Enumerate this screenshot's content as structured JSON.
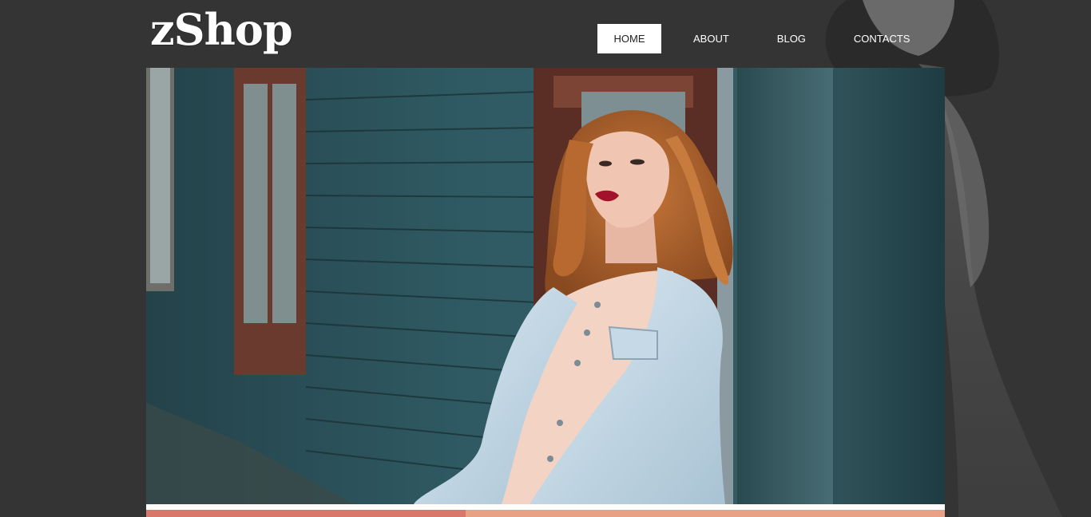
{
  "header": {
    "logo_text": "zShop"
  },
  "nav": {
    "items": [
      {
        "label": "HOME",
        "active": true
      },
      {
        "label": "ABOUT",
        "active": false
      },
      {
        "label": "BLOG",
        "active": false
      },
      {
        "label": "CONTACTS",
        "active": false
      }
    ]
  },
  "colors": {
    "page_background": "#343434",
    "nav_active_bg": "#ffffff",
    "promo_left": "#d9786a",
    "promo_right": "#e8a184"
  }
}
